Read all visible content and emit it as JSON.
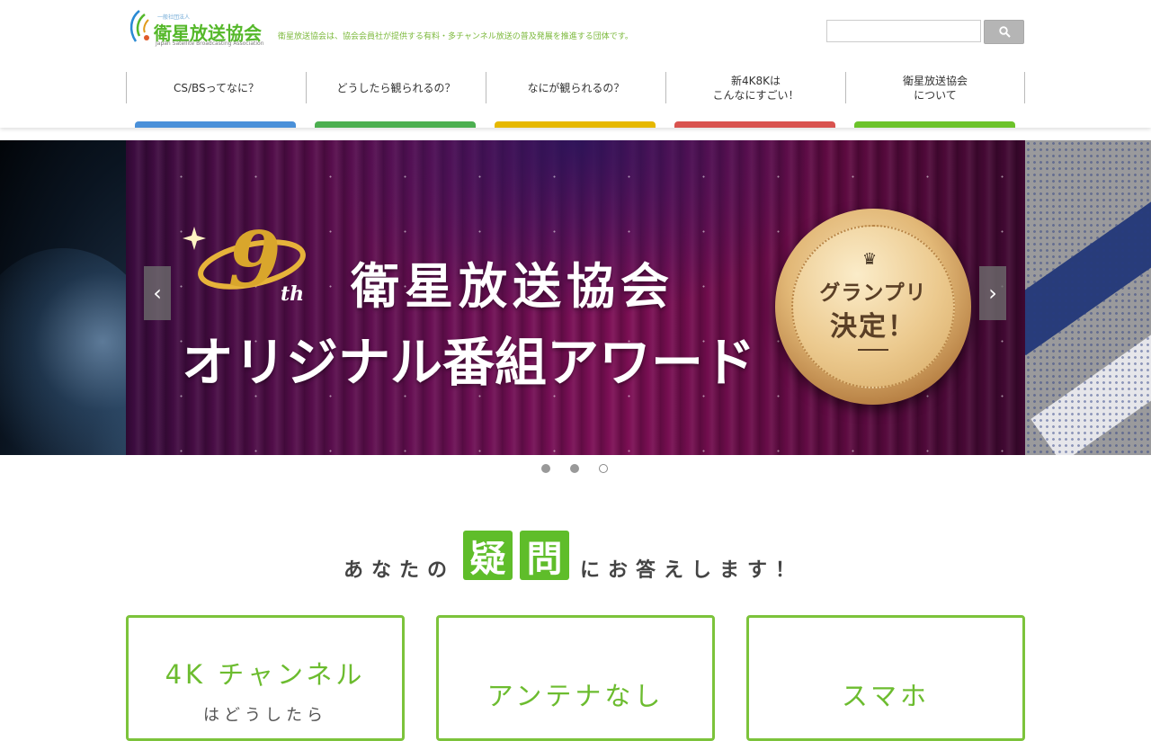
{
  "header": {
    "logo": {
      "small_text": "一般社団法人",
      "main_text": "衛星放送協会",
      "english_text": "Japan Satellite Broadcasting Association"
    },
    "tagline": "衛星放送協会は、協会会員社が提供する有料・多チャンネル放送の普及発展を推進する団体です。",
    "search": {
      "placeholder": "",
      "button_icon": "search-icon"
    }
  },
  "nav": {
    "items": [
      {
        "label": "CS/BSってなに？",
        "color": "#4a90d9"
      },
      {
        "label": "どうしたら観られるの？",
        "color": "#4caf50"
      },
      {
        "label": "なにが観られるの？",
        "color": "#e6b800"
      },
      {
        "label": "新4K8Kは\nこんなにすごい！",
        "color": "#d9534f"
      },
      {
        "label": "衛星放送協会\nについて",
        "color": "#6cc32a"
      }
    ]
  },
  "slider": {
    "slide": {
      "ordinal_mark": "9th",
      "title_line1": "衛星放送協会",
      "title_line2": "オリジナル番組アワード",
      "medal_line1": "グランプリ",
      "medal_line2": "決定！"
    },
    "prev_icon": "chevron-left-icon",
    "next_icon": "chevron-right-icon",
    "active_index": 2,
    "slide_count": 3
  },
  "section": {
    "heading_pre": "あなたの",
    "heading_box1": "疑",
    "heading_box2": "問",
    "heading_post": "にお答えします！"
  },
  "cards": [
    {
      "title": "4K チャンネル",
      "subtitle": "はどうしたら"
    },
    {
      "title": "アンテナなし",
      "subtitle": ""
    },
    {
      "title": "スマホ",
      "subtitle": ""
    }
  ],
  "colors": {
    "brand_green": "#55b82a",
    "card_border": "#7cc33b"
  }
}
